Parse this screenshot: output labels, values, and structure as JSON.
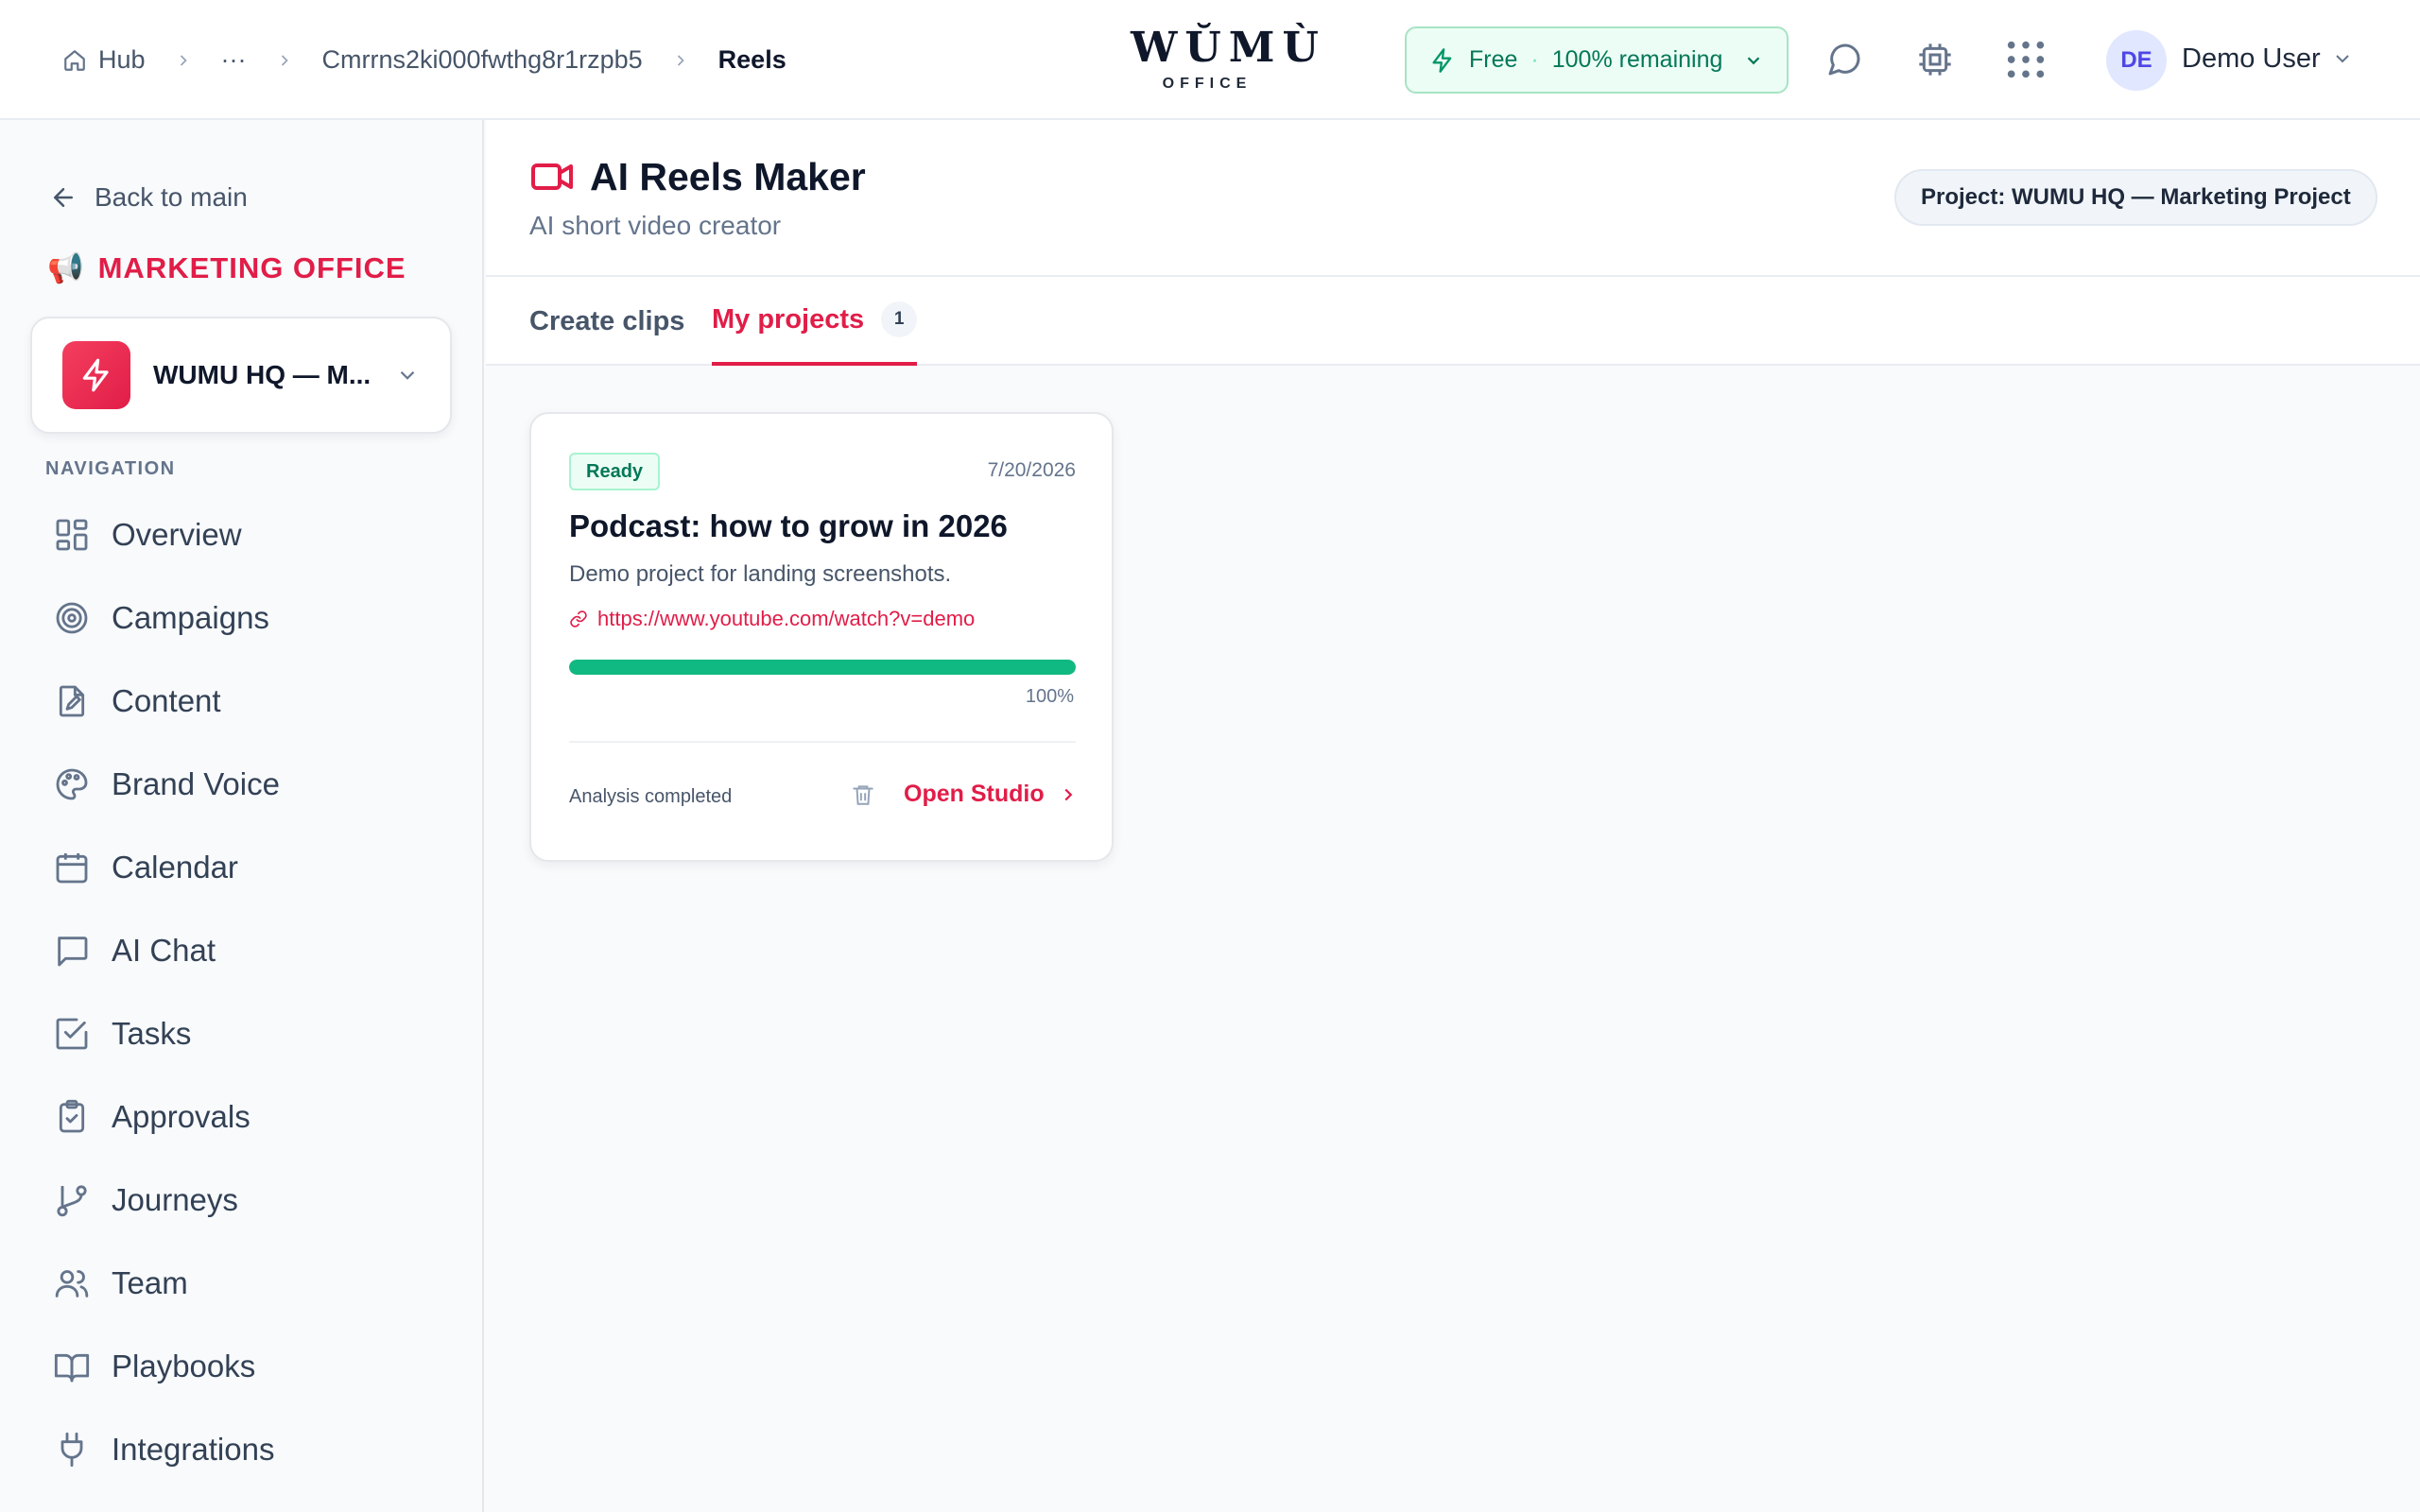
{
  "breadcrumb": {
    "hub": "Hub",
    "ellipsis": "···",
    "id": "Cmrrns2ki000fwthg8r1rzpb5",
    "current": "Reels"
  },
  "logo": {
    "main": "WŬMÙ",
    "sub": "OFFICE"
  },
  "plan": {
    "name": "Free",
    "separator": "·",
    "remaining": "100% remaining"
  },
  "user": {
    "initials": "DE",
    "name": "Demo User"
  },
  "sidebar": {
    "back": "Back to main",
    "office_emoji": "📢",
    "office": "MARKETING OFFICE",
    "workspace": "WUMU HQ — M...",
    "nav_label": "NAVIGATION",
    "items": [
      {
        "label": "Overview",
        "icon": "layout-grid-icon"
      },
      {
        "label": "Campaigns",
        "icon": "target-icon"
      },
      {
        "label": "Content",
        "icon": "file-edit-icon"
      },
      {
        "label": "Brand Voice",
        "icon": "palette-icon"
      },
      {
        "label": "Calendar",
        "icon": "calendar-icon"
      },
      {
        "label": "AI Chat",
        "icon": "message-square-icon"
      },
      {
        "label": "Tasks",
        "icon": "check-square-icon"
      },
      {
        "label": "Approvals",
        "icon": "clipboard-check-icon"
      },
      {
        "label": "Journeys",
        "icon": "git-branch-icon"
      },
      {
        "label": "Team",
        "icon": "users-icon"
      },
      {
        "label": "Playbooks",
        "icon": "book-open-icon"
      },
      {
        "label": "Integrations",
        "icon": "plug-icon"
      }
    ]
  },
  "page": {
    "title": "AI Reels Maker",
    "subtitle": "AI short video creator",
    "project_pill": "Project: WUMU HQ — Marketing Project"
  },
  "tabs": [
    {
      "label": "Create clips",
      "active": false
    },
    {
      "label": "My projects",
      "active": true,
      "count": "1"
    }
  ],
  "projects": [
    {
      "status": "Ready",
      "date": "7/20/2026",
      "title": "Podcast: how to grow in 2026",
      "description": "Demo project for landing screenshots.",
      "link": "https://www.youtube.com/watch?v=demo",
      "progress": 100,
      "progress_label": "100%",
      "analysis": "Analysis completed",
      "action": "Open Studio"
    }
  ],
  "colors": {
    "accent": "#e11d48",
    "success": "#10b981",
    "success_bg": "#ecfdf5"
  }
}
